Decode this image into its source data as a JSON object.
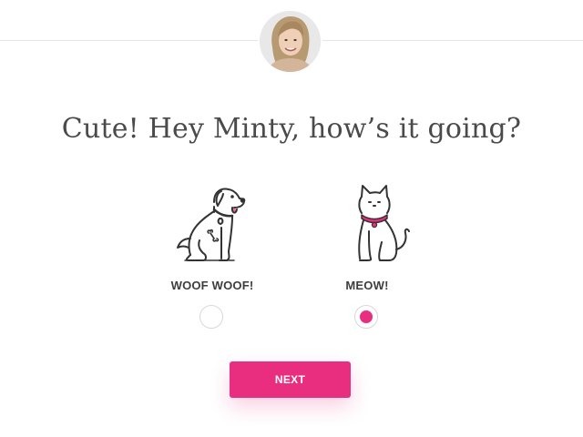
{
  "header": {
    "avatar_icon": "user-portrait-icon"
  },
  "main": {
    "headline": "Cute! Hey Minty, how’s it going?",
    "options": [
      {
        "id": "dog",
        "label": "WOOF WOOF!",
        "icon": "dog-icon",
        "selected": false
      },
      {
        "id": "cat",
        "label": "MEOW!",
        "icon": "cat-icon",
        "selected": true
      }
    ],
    "next_label": "NEXT"
  },
  "colors": {
    "accent": "#e92e7f",
    "text": "#4a4a4a",
    "line_art": "#333333"
  }
}
